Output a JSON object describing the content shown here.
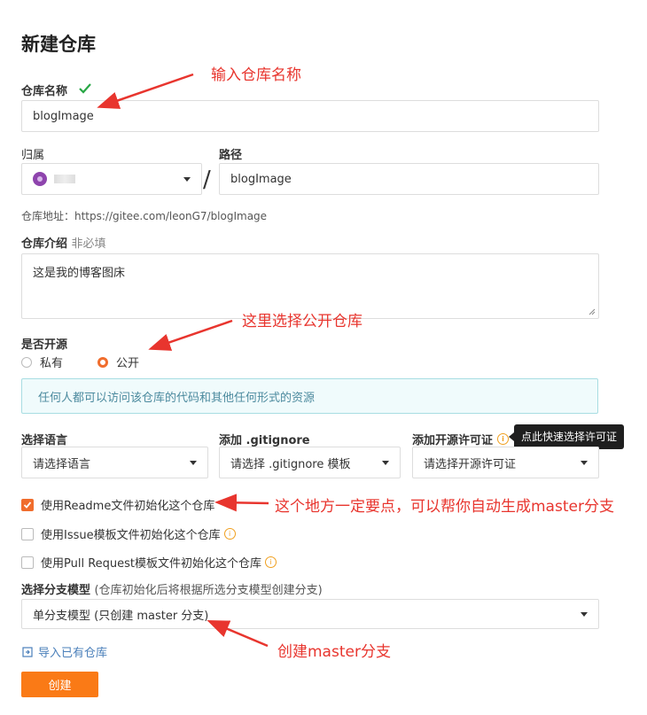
{
  "page_title": "新建仓库",
  "repo_name": {
    "label": "仓库名称",
    "value": "blogImage"
  },
  "owner": {
    "label": "归属",
    "value": ""
  },
  "path": {
    "label": "路径",
    "separator": "/",
    "value": "blogImage"
  },
  "repo_url": {
    "text": "仓库地址：https://gitee.com/leonG7/blogImage"
  },
  "intro": {
    "label": "仓库介绍",
    "optional": "非必填",
    "value": "这是我的博客图床"
  },
  "open_source": {
    "label": "是否开源",
    "options": [
      {
        "label": "私有",
        "selected": false
      },
      {
        "label": "公开",
        "selected": true
      }
    ],
    "notice": "任何人都可以访问该仓库的代码和其他任何形式的资源"
  },
  "language": {
    "label": "选择语言",
    "placeholder": "请选择语言"
  },
  "gitignore": {
    "label": "添加 .gitignore",
    "placeholder": "请选择 .gitignore 模板"
  },
  "license": {
    "label": "添加开源许可证",
    "placeholder": "请选择开源许可证",
    "tooltip": "点此快速选择许可证"
  },
  "init_options": [
    {
      "label": "使用Readme文件初始化这个仓库",
      "checked": true
    },
    {
      "label": "使用Issue模板文件初始化这个仓库",
      "checked": false
    },
    {
      "label": "使用Pull Request模板文件初始化这个仓库",
      "checked": false
    }
  ],
  "branch_model": {
    "label": "选择分支模型",
    "hint": "(仓库初始化后将根据所选分支模型创建分支)",
    "value": "单分支模型 (只创建 master 分支)"
  },
  "import_link": "导入已有仓库",
  "create_button": "创建",
  "annotations": {
    "name": "输入仓库名称",
    "public": "这里选择公开仓库",
    "readme": "这个地方一定要点，可以帮你自动生成master分支",
    "branch": "创建master分支"
  },
  "colors": {
    "accent": "#f06d2d",
    "button": "#fa7a16",
    "annotation": "#e8352e",
    "check": "#28a745"
  }
}
